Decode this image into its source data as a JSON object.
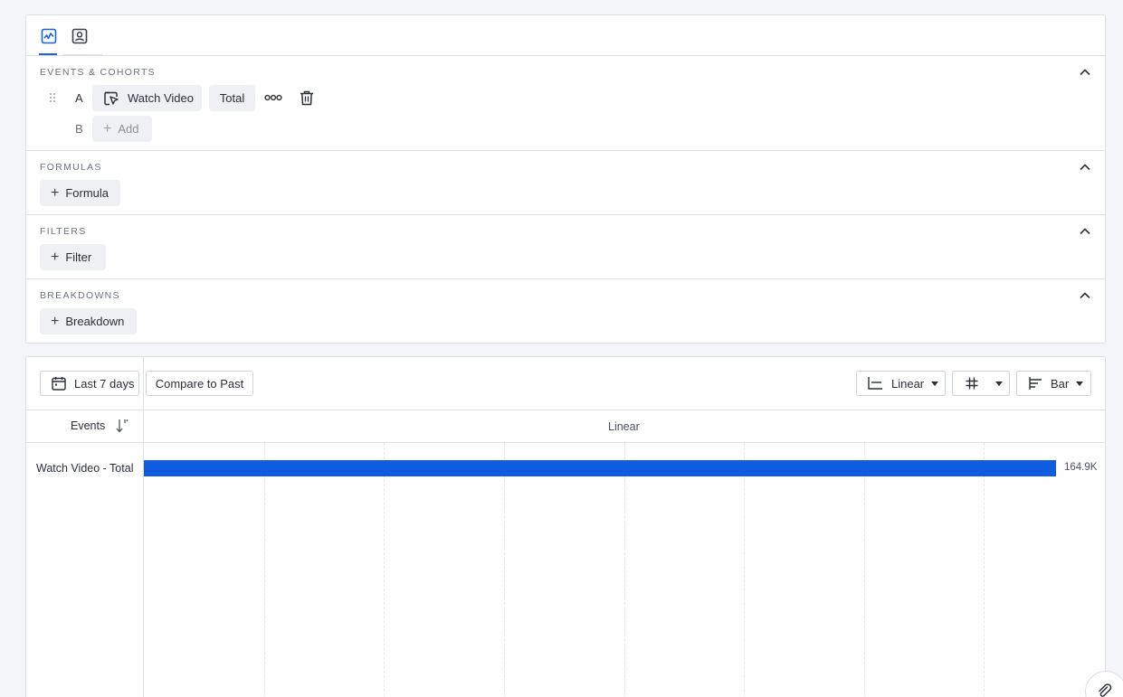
{
  "tabs": [
    {
      "icon": "line-chart-icon",
      "active": true
    },
    {
      "icon": "cohort-user-icon",
      "active": false
    }
  ],
  "sections": {
    "events": {
      "title": "EVENTS & COHORTS",
      "rows": [
        {
          "letter": "A",
          "event": "Watch Video",
          "measure": "Total"
        },
        {
          "letter": "B",
          "add_label": "Add"
        }
      ]
    },
    "formulas": {
      "title": "FORMULAS",
      "add_label": "Formula"
    },
    "filters": {
      "title": "FILTERS",
      "add_label": "Filter"
    },
    "breakdowns": {
      "title": "BREAKDOWNS",
      "add_label": "Breakdown"
    }
  },
  "toolbar": {
    "date_range": "Last 7 days",
    "compare": "Compare to Past",
    "scale": "Linear",
    "chart_type": "Bar"
  },
  "table": {
    "events_header": "Events",
    "axis_header": "Linear"
  },
  "chart_data": {
    "type": "bar",
    "orientation": "horizontal",
    "categories": [
      "Watch Video - Total"
    ],
    "values": [
      164900
    ],
    "value_labels": [
      "164.9K"
    ],
    "grid": true
  },
  "colors": {
    "accent": "#1a62e5",
    "bar": "#0f5ce0"
  }
}
